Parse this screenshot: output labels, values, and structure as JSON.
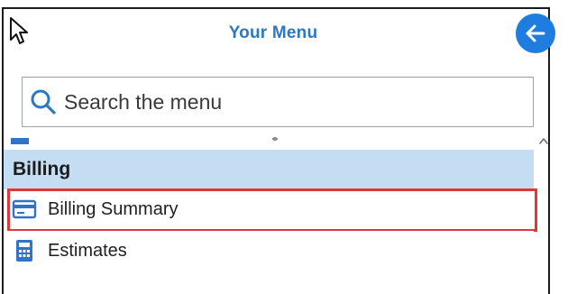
{
  "header": {
    "title": "Your Menu"
  },
  "search": {
    "placeholder": "Search the menu",
    "value": ""
  },
  "menu": {
    "section_title": "Billing",
    "items": [
      {
        "label": "Billing Summary",
        "icon": "credit-card-icon"
      },
      {
        "label": "Estimates",
        "icon": "calculator-icon"
      }
    ]
  },
  "colors": {
    "accent": "#2b78c4",
    "back_button": "#1f7de0",
    "section_bg": "#c5ddf2",
    "highlight": "#e0383a"
  }
}
